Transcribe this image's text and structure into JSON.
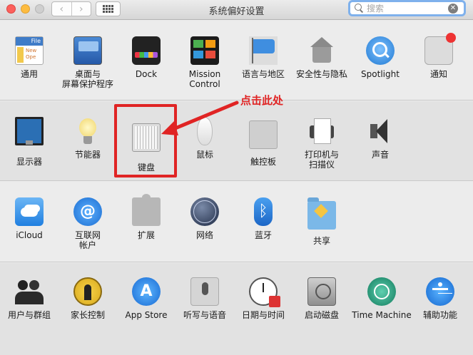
{
  "window": {
    "title": "系统偏好设置",
    "back_icon": "chevron-left-icon",
    "forward_icon": "chevron-right-icon",
    "grid_icon": "show-all-grid-icon"
  },
  "search": {
    "placeholder": "搜索",
    "clear_icon": "clear-icon"
  },
  "sections": [
    {
      "items": [
        {
          "label": "通用",
          "icon": "general-icon"
        },
        {
          "label": "桌面与\n屏幕保护程序",
          "icon": "desktop-icon"
        },
        {
          "label": "Dock",
          "icon": "dock-icon"
        },
        {
          "label": "Mission\nControl",
          "icon": "mission-control-icon"
        },
        {
          "label": "语言与地区",
          "icon": "language-flag-icon"
        },
        {
          "label": "安全性与隐私",
          "icon": "security-house-icon"
        },
        {
          "label": "Spotlight",
          "icon": "spotlight-icon"
        },
        {
          "label": "通知",
          "icon": "notifications-icon"
        }
      ]
    },
    {
      "items": [
        {
          "label": "显示器",
          "icon": "display-icon"
        },
        {
          "label": "节能器",
          "icon": "energy-bulb-icon"
        },
        {
          "label": "键盘",
          "icon": "keyboard-icon"
        },
        {
          "label": "鼠标",
          "icon": "mouse-icon"
        },
        {
          "label": "触控板",
          "icon": "trackpad-icon"
        },
        {
          "label": "打印机与\n扫描仪",
          "icon": "printer-icon"
        },
        {
          "label": "声音",
          "icon": "speaker-icon"
        }
      ]
    },
    {
      "items": [
        {
          "label": "iCloud",
          "icon": "icloud-icon"
        },
        {
          "label": "互联网\n帐户",
          "icon": "internet-accounts-icon"
        },
        {
          "label": "扩展",
          "icon": "extensions-puzzle-icon"
        },
        {
          "label": "网络",
          "icon": "network-globe-icon"
        },
        {
          "label": "蓝牙",
          "icon": "bluetooth-icon"
        },
        {
          "label": "共享",
          "icon": "sharing-folder-icon"
        }
      ]
    },
    {
      "items": [
        {
          "label": "用户与群组",
          "icon": "users-icon"
        },
        {
          "label": "家长控制",
          "icon": "parental-controls-icon"
        },
        {
          "label": "App Store",
          "icon": "app-store-icon"
        },
        {
          "label": "听写与语音",
          "icon": "dictation-mic-icon"
        },
        {
          "label": "日期与时间",
          "icon": "date-time-clock-icon"
        },
        {
          "label": "启动磁盘",
          "icon": "startup-disk-icon"
        },
        {
          "label": "Time Machine",
          "icon": "time-machine-icon"
        },
        {
          "label": "辅助功能",
          "icon": "accessibility-icon"
        }
      ]
    }
  ],
  "annotation": {
    "text": "点击此处",
    "color": "#e02424"
  },
  "icon_glyphs": {
    "file_header": "File",
    "file_text": "New\nOpe",
    "internet": "@",
    "app_store": "A",
    "bluetooth": "ᛒ"
  }
}
